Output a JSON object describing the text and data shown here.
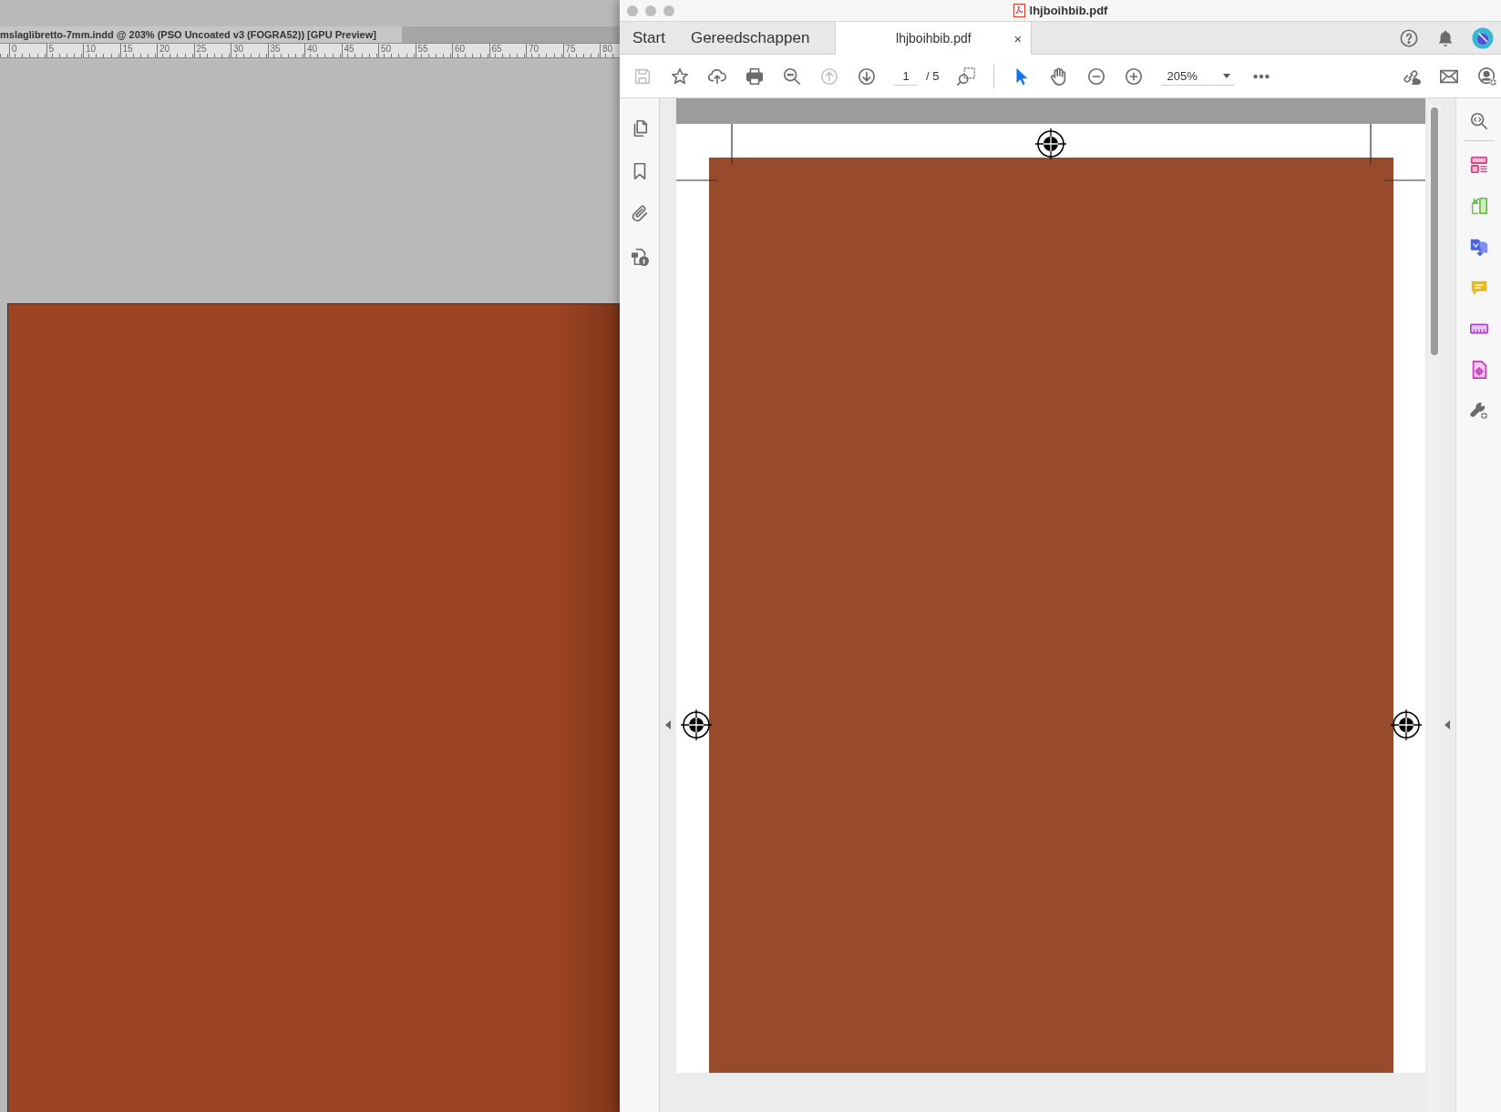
{
  "background_app": {
    "document_tab": "mslaglibretto-7mm.indd @ 203% (PSO Uncoated v3 (FOGRA52)) [GPU Preview]",
    "ruler_labels": [
      "0",
      "5",
      "10",
      "15",
      "20",
      "25",
      "30",
      "35",
      "40",
      "45",
      "50",
      "55",
      "60",
      "65",
      "70",
      "75",
      "80"
    ]
  },
  "window": {
    "title": "lhjboihbib.pdf"
  },
  "tabs": [
    {
      "label": "Start",
      "selected": false
    },
    {
      "label": "Gereedschappen",
      "selected": false
    },
    {
      "label": "lhjboihbib.pdf",
      "selected": true,
      "close": "×"
    }
  ],
  "header_icons": [
    {
      "kind": "help"
    },
    {
      "kind": "bell"
    },
    {
      "kind": "avatar"
    }
  ],
  "toolbar": {
    "left": [
      {
        "kind": "save",
        "disabled": true
      },
      {
        "kind": "star",
        "disabled": false
      },
      {
        "kind": "upload",
        "disabled": false
      },
      {
        "kind": "print",
        "disabled": false
      },
      {
        "kind": "search",
        "disabled": false
      },
      {
        "kind": "up",
        "disabled": true
      },
      {
        "kind": "down",
        "disabled": false
      }
    ],
    "page": {
      "value": "1",
      "total": "/ 5"
    },
    "modes": [
      {
        "kind": "select",
        "selected": true
      },
      {
        "kind": "hand",
        "selected": false
      }
    ],
    "zoom": [
      {
        "kind": "zoom-out"
      },
      {
        "kind": "zoom-in"
      }
    ],
    "zoom_level": "205%",
    "right": [
      {
        "kind": "share"
      },
      {
        "kind": "mail"
      },
      {
        "kind": "user-add"
      }
    ]
  },
  "left_rail": [
    {
      "kind": "pages"
    },
    {
      "kind": "bookmark"
    },
    {
      "kind": "attachment"
    },
    {
      "kind": "info"
    }
  ],
  "right_pane": [
    {
      "kind": "enhance"
    },
    {
      "kind": "organize"
    },
    {
      "kind": "export"
    },
    {
      "kind": "create"
    },
    {
      "kind": "comment"
    },
    {
      "kind": "measure"
    },
    {
      "kind": "print-production"
    },
    {
      "kind": "more-tools"
    }
  ]
}
